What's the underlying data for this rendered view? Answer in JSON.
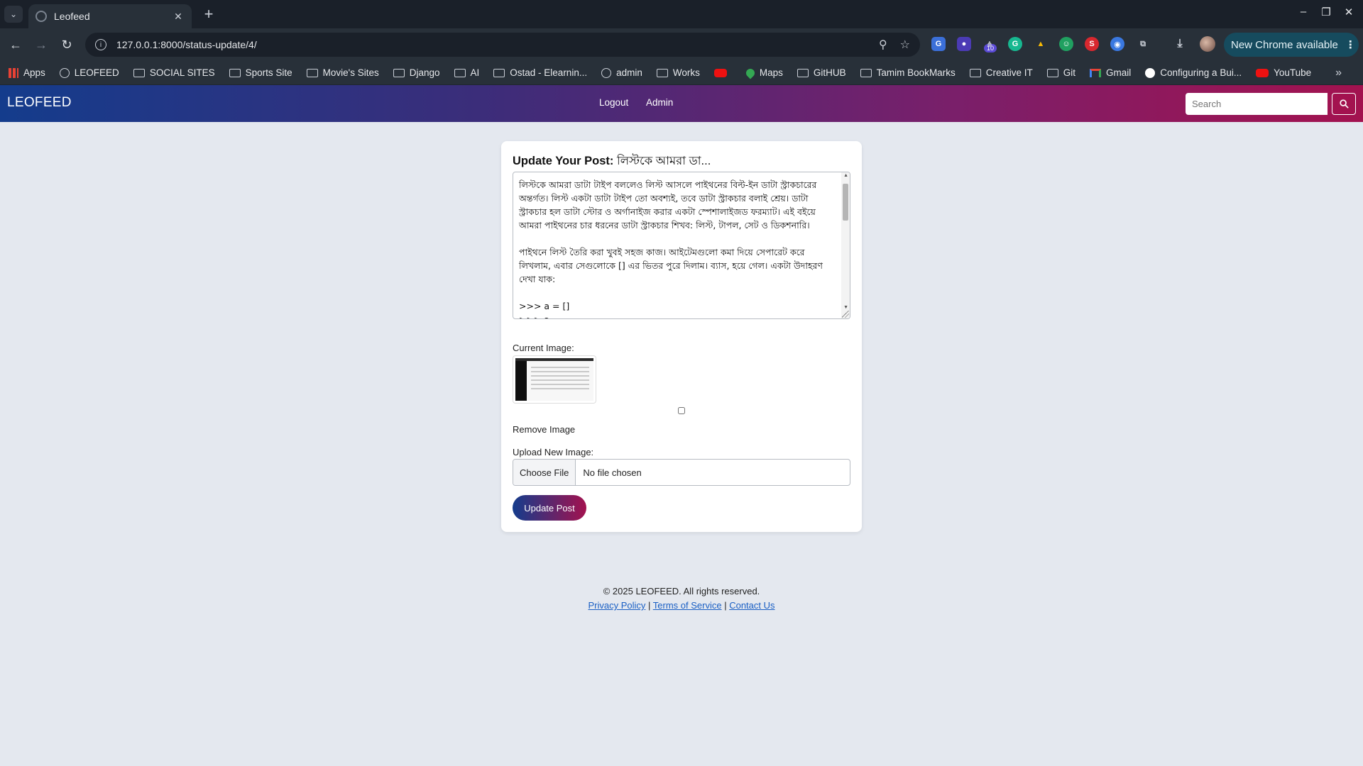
{
  "browser": {
    "tab_title": "Leofeed",
    "url": "127.0.0.1:8000/status-update/4/",
    "extension_badge": "10",
    "update_pill": "New Chrome available",
    "bookmarks": [
      {
        "label": "Apps",
        "icon": "apps-grid-icon"
      },
      {
        "label": "LEOFEED",
        "icon": "globe-icon"
      },
      {
        "label": "SOCIAL SITES",
        "icon": "folder-icon"
      },
      {
        "label": "Sports Site",
        "icon": "folder-icon"
      },
      {
        "label": "Movie's Sites",
        "icon": "folder-icon"
      },
      {
        "label": "Django",
        "icon": "folder-icon"
      },
      {
        "label": "AI",
        "icon": "folder-icon"
      },
      {
        "label": "Ostad - Elearnin...",
        "icon": "folder-icon"
      },
      {
        "label": "admin",
        "icon": "globe-icon"
      },
      {
        "label": "Works",
        "icon": "folder-icon"
      },
      {
        "label": "",
        "icon": "youtube-icon"
      },
      {
        "label": "Maps",
        "icon": "maps-icon"
      },
      {
        "label": "GitHUB",
        "icon": "folder-icon"
      },
      {
        "label": "Tamim BookMarks",
        "icon": "folder-icon"
      },
      {
        "label": "Creative IT",
        "icon": "folder-icon"
      },
      {
        "label": "Git",
        "icon": "folder-icon"
      },
      {
        "label": "Gmail",
        "icon": "gmail-icon"
      },
      {
        "label": "Configuring a Bui...",
        "icon": "triangle-logo-icon"
      },
      {
        "label": "YouTube",
        "icon": "youtube-icon"
      }
    ]
  },
  "site": {
    "brand": "LEOFEED",
    "nav": {
      "logout": "Logout",
      "admin": "Admin"
    },
    "search_placeholder": "Search",
    "colors": {
      "gradient_start": "#143c8c",
      "gradient_end": "#a3124f"
    }
  },
  "form": {
    "title_bold": "Update Your Post:",
    "title_rest": " লিস্টকে আমরা ডা...",
    "body_text": "লিস্টকে আমরা ডাটা টাইপ বললেও লিস্ট আসলে পাইথনের বিল্ট-ইন ডাটা স্ট্রাকচারের অন্তর্গত। লিস্ট একটা ডাটা টাইপ তো অবশ্যই, তবে ডাটা স্ট্রাকচার বলাই শ্রেয়। ডাটা স্ট্রাকচার হল ডাটা স্টোর ও অর্গানাইজ করার একটা স্পেশালাইজড ফরম্যাট। এই বইয়ে আমরা পাইথনের চার ধরনের ডাটা স্ট্রাকচার শিখব: লিস্ট, টাপল, সেট ও ডিকশনারি।\n\nপাইথনে লিস্ট তৈরি করা খুবই সহজ কাজ। আইটেমগুলো কমা দিয়ে সেপারেট করে লিখলাম, এবার সেগুলোকে [] এর ভিতর পুরে দিলাম। ব্যাস, হয়ে গেল। একটা উদাহরণ দেখা যাক:\n\n>>> a = []\n>>> a",
    "current_image_label": "Current Image:",
    "remove_image_label": "Remove Image",
    "upload_label": "Upload New Image:",
    "choose_file": "Choose File",
    "no_file": "No file chosen",
    "submit": "Update Post"
  },
  "footer": {
    "copyright": "© 2025 LEOFEED. All rights reserved.",
    "privacy": "Privacy Policy",
    "sep1": " | ",
    "terms": "Terms of Service",
    "sep2": " | ",
    "contact": "Contact Us"
  }
}
